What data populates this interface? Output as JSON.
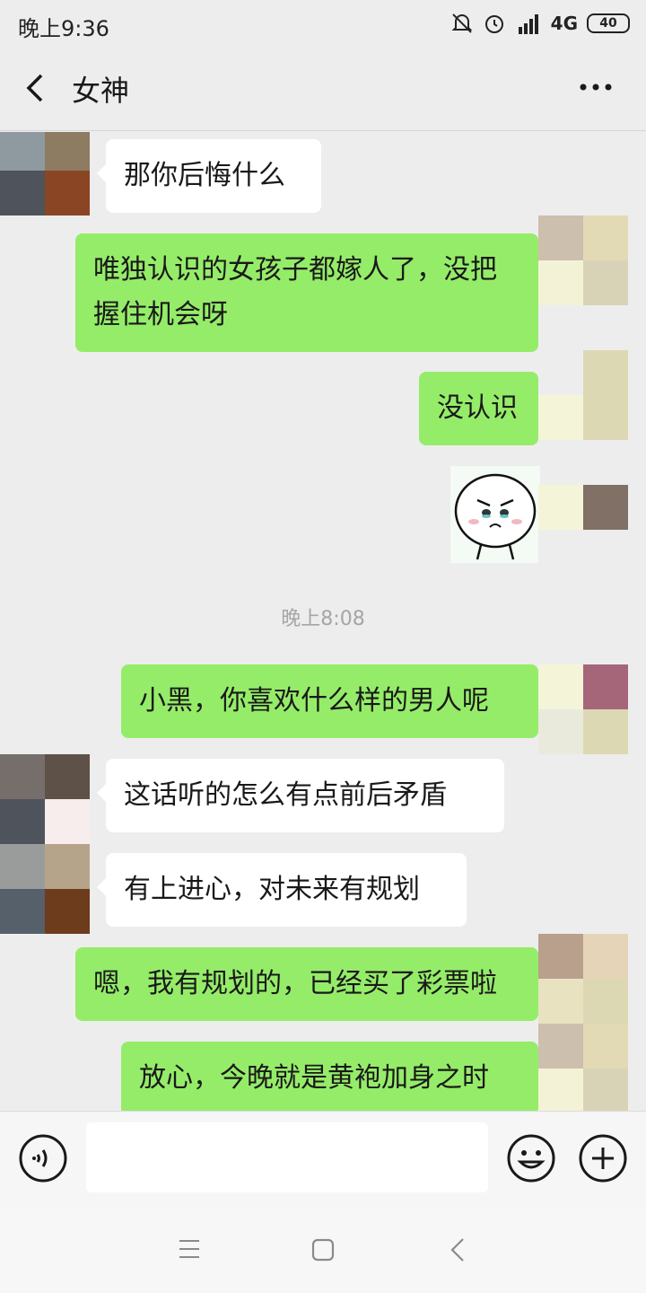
{
  "status_bar": {
    "time": "晚上9:36",
    "network": "4G",
    "battery": "40",
    "icons": [
      "mute-bell-icon",
      "alarm-icon",
      "hd-signal-icon",
      "battery-icon"
    ]
  },
  "header": {
    "title": "女神",
    "back_icon": "chevron-left-icon",
    "more_icon": "ellipsis-icon"
  },
  "messages": [
    {
      "side": "in",
      "text": "那你后悔什么"
    },
    {
      "side": "out",
      "text": "唯独认识的女孩子都嫁人了，没把握住机会呀"
    },
    {
      "side": "out",
      "text": "没认识"
    },
    {
      "side": "out",
      "type": "sticker",
      "sticker": "angry-face-sticker"
    },
    {
      "type": "timestamp",
      "text": "晚上8:08"
    },
    {
      "side": "out",
      "text": "小黑，你喜欢什么样的男人呢"
    },
    {
      "side": "in",
      "text": "这话听的怎么有点前后矛盾"
    },
    {
      "side": "in",
      "text": "有上进心，对未来有规划"
    },
    {
      "side": "out",
      "text": "嗯，我有规划的，已经买了彩票啦"
    },
    {
      "side": "out",
      "text": "放心，今晚就是黄袍加身之时"
    }
  ],
  "input_bar": {
    "placeholder": "",
    "icons": [
      "voice-icon",
      "emoji-icon",
      "plus-icon"
    ]
  },
  "nav_bar": {
    "icons": [
      "menu-icon",
      "home-icon",
      "back-icon"
    ]
  },
  "colors": {
    "background": "#ededed",
    "bubble_out": "#95ec69",
    "bubble_in": "#ffffff",
    "timestamp": "#a5a5a5"
  }
}
